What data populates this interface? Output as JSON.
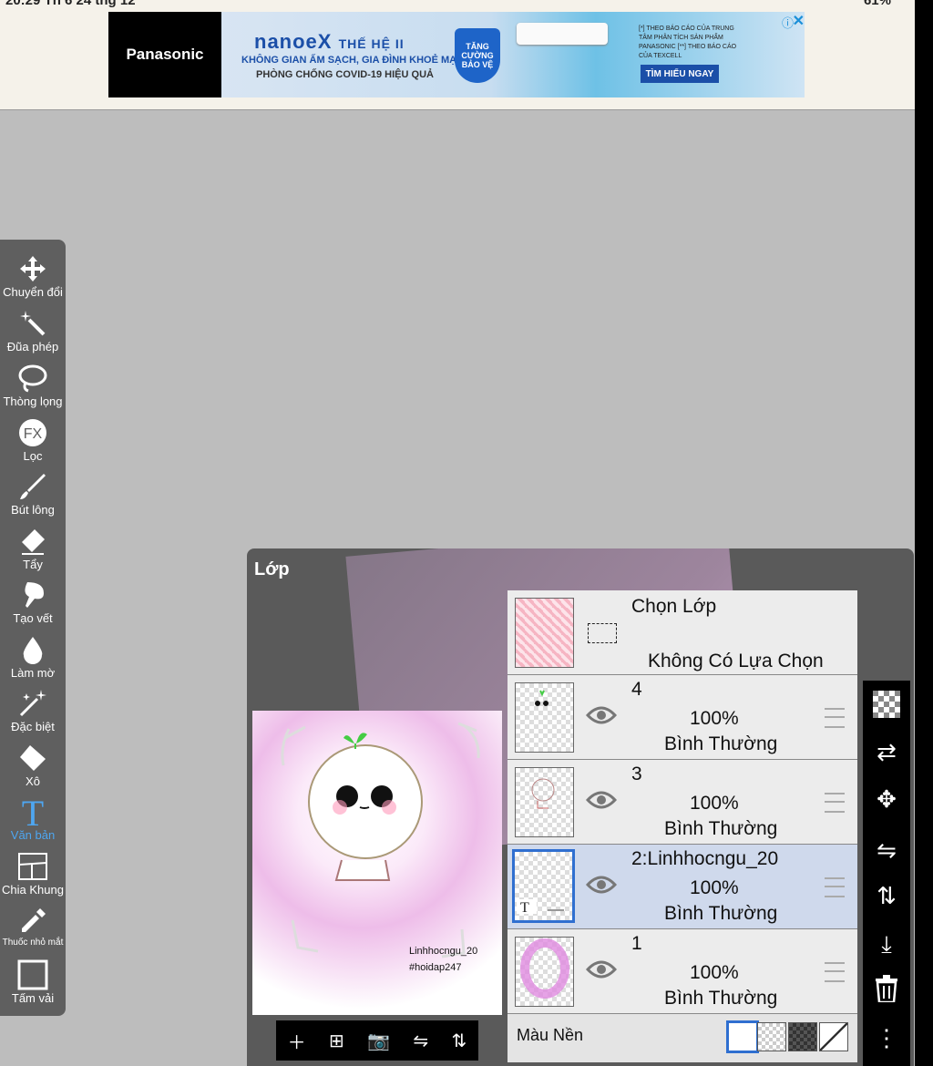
{
  "status": {
    "time": "20:29 Th 6 24 thg 12",
    "battery": "61%"
  },
  "ad": {
    "brand": "Panasonic",
    "title": "nanoeX",
    "title_suffix": "THẾ HỆ II",
    "line1": "KHÔNG GIAN ẤM SẠCH, GIA ĐÌNH KHOẺ MẠNH",
    "line2": "PHÒNG CHỐNG COVID-19 HIỆU QUẢ",
    "badge": "TĂNG CƯỜNG BẢO VỆ",
    "note": "[*] THEO BÁO CÁO CỦA TRUNG TÂM PHÂN TÍCH SẢN PHẨM PANASONIC [**] THEO BÁO CÁO CỦA TEXCELL",
    "cta": "TÌM HIỂU NGAY"
  },
  "tools": [
    {
      "label": "Chuyển đổi",
      "icon": "move-icon"
    },
    {
      "label": "Đũa phép",
      "icon": "magic-wand-icon"
    },
    {
      "label": "Thòng lọng",
      "icon": "lasso-icon"
    },
    {
      "label": "Lọc",
      "icon": "fx-icon"
    },
    {
      "label": "Bút lông",
      "icon": "brush-icon"
    },
    {
      "label": "Tẩy",
      "icon": "eraser-icon"
    },
    {
      "label": "Tạo vết",
      "icon": "smudge-icon"
    },
    {
      "label": "Làm mờ",
      "icon": "blur-drop-icon"
    },
    {
      "label": "Đặc biệt",
      "icon": "special-sparkle-icon"
    },
    {
      "label": "Xô",
      "icon": "bucket-icon"
    },
    {
      "label": "Văn bản",
      "icon": "text-icon",
      "active": true
    },
    {
      "label": "Chia Khung",
      "icon": "frame-divider-icon"
    },
    {
      "label": "Thuốc nhỏ mắt",
      "icon": "eyedropper-icon"
    },
    {
      "label": "Tấm vải",
      "icon": "canvas-icon"
    }
  ],
  "layers_panel": {
    "title": "Lớp",
    "preview_text": [
      "Linhhocngu_20",
      "#hoidap247"
    ],
    "selection": {
      "title": "Chọn Lớp",
      "subtitle": "Không Có Lựa Chọn"
    },
    "layers": [
      {
        "name": "4",
        "opacity": "100%",
        "mode": "Bình Thường",
        "selected": false
      },
      {
        "name": "3",
        "opacity": "100%",
        "mode": "Bình Thường",
        "selected": false
      },
      {
        "name": "2:Linhhocngu_20",
        "opacity": "100%",
        "mode": "Bình Thường",
        "selected": true
      },
      {
        "name": "1",
        "opacity": "100%",
        "mode": "Bình Thường",
        "selected": false
      }
    ],
    "background_label": "Màu Nền",
    "background_swatches": [
      "white",
      "checker-light",
      "checker-dark",
      "none"
    ]
  },
  "bottom_actions": [
    "add-layer-icon",
    "add-layer-box-icon",
    "camera-icon",
    "flip-horizontal-icon",
    "flip-vertical-icon"
  ],
  "right_tools": [
    "transparency-icon",
    "layer-transfer-icon",
    "move-layer-icon",
    "flip-h-icon",
    "flip-v-icon",
    "merge-down-icon",
    "trash-icon",
    "more-icon"
  ],
  "colors": {
    "accent": "#4ea6f0",
    "selected_row": "#cfd9ec",
    "toolbar": "#5f5f5f"
  }
}
